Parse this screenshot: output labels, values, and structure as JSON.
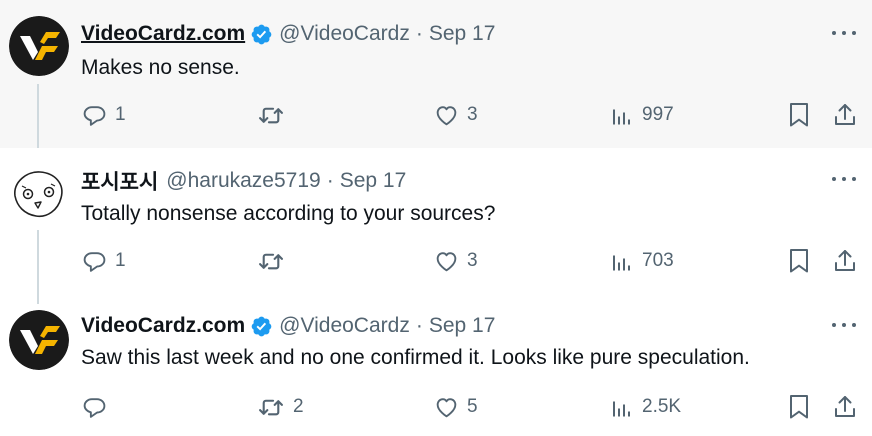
{
  "tweets": [
    {
      "name": "VideoCardz.com",
      "handle": "@VideoCardz",
      "sep": "·",
      "date": "Sep 17",
      "verified": true,
      "avatar_icon": "videocardz-logo",
      "text": "Makes no sense.",
      "replies": "1",
      "retweets": "",
      "likes": "3",
      "views": "997"
    },
    {
      "name": "포시포시",
      "handle": "@harukaze5719",
      "sep": "·",
      "date": "Sep 17",
      "verified": false,
      "avatar_icon": "cartoon-face",
      "text": "Totally nonsense according to your sources?",
      "replies": "1",
      "retweets": "",
      "likes": "3",
      "views": "703"
    },
    {
      "name": "VideoCardz.com",
      "handle": "@VideoCardz",
      "sep": "·",
      "date": "Sep 17",
      "verified": true,
      "avatar_icon": "videocardz-logo",
      "text": "Saw this last week and no one confirmed it. Looks like pure speculation.",
      "replies": "",
      "retweets": "2",
      "likes": "5",
      "views": "2.5K"
    }
  ],
  "colors": {
    "verified": "#1d9bf0",
    "secondary_text": "#536471",
    "primary_text": "#0f1419",
    "hover_background": "#f7f7f7",
    "thread_line": "#cfd9de",
    "logo_gold": "#f5b400"
  },
  "icons": [
    "reply-icon",
    "retweet-icon",
    "like-icon",
    "views-icon",
    "bookmark-icon",
    "share-icon",
    "more-icon",
    "verified-badge-icon"
  ]
}
